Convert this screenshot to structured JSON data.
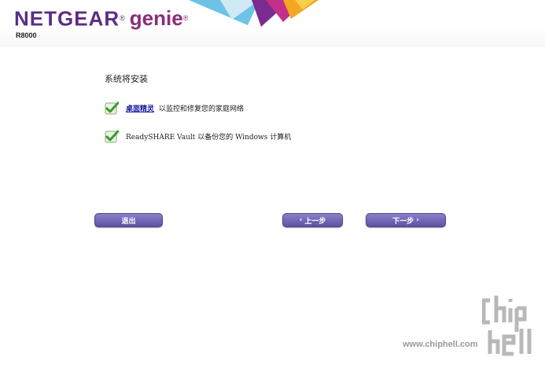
{
  "header": {
    "brand": "NETGEAR",
    "brand_mark": "®",
    "product": "genie",
    "product_mark": "®",
    "model": "R8000"
  },
  "main": {
    "title": "系统将安装",
    "items": [
      {
        "checked": true,
        "link_text": "桌面精灵",
        "text": "以监控和修复您的家庭网络"
      },
      {
        "checked": true,
        "text": "ReadySHARE Vault 以备份您的 Windows 计算机"
      }
    ]
  },
  "buttons": {
    "exit": "退出",
    "prev": "上一步",
    "next": "下一步",
    "prev_icon": "chevron-left-icon",
    "next_icon": "chevron-right-icon"
  },
  "watermark": {
    "url": "www.chiphell.com"
  },
  "colors": {
    "brand_purple": "#5b2d86",
    "button": "#6a60b0",
    "check_green": "#3a9a2a"
  }
}
